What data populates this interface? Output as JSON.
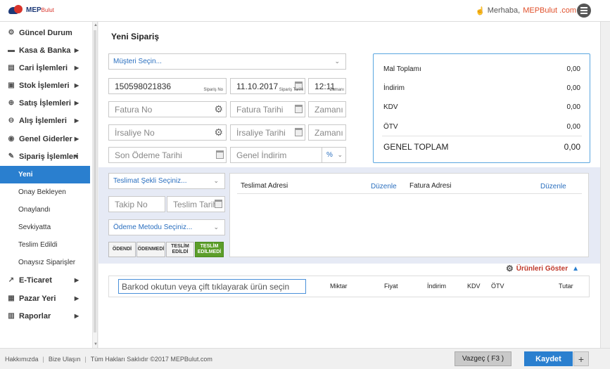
{
  "header": {
    "logo_main": "MEP",
    "logo_sub": "Bulut",
    "greeting": "Merhaba,",
    "brand": "MEPBulut .com"
  },
  "sidebar": {
    "items": [
      {
        "label": "Güncel Durum",
        "icon": "dashboard-icon"
      },
      {
        "label": "Kasa & Banka",
        "icon": "cash-icon"
      },
      {
        "label": "Cari İşlemleri",
        "icon": "accounts-icon"
      },
      {
        "label": "Stok İşlemleri",
        "icon": "stock-icon"
      },
      {
        "label": "Satış İşlemleri",
        "icon": "sales-icon"
      },
      {
        "label": "Alış İşlemleri",
        "icon": "purchase-icon"
      },
      {
        "label": "Genel Giderler",
        "icon": "expenses-icon"
      },
      {
        "label": "Sipariş İşlemleri",
        "icon": "orders-icon"
      },
      {
        "label": "E-Ticaret",
        "icon": "ecommerce-icon"
      },
      {
        "label": "Pazar Yeri",
        "icon": "marketplace-icon"
      },
      {
        "label": "Raporlar",
        "icon": "reports-icon"
      }
    ],
    "sub_items": [
      "Yeni",
      "Onay Bekleyen",
      "Onaylandı",
      "Sevkiyatta",
      "Teslim Edildi",
      "Onaysız Siparişler"
    ]
  },
  "main": {
    "title": "Yeni Sipariş",
    "customer_select": "Müşteri Seçin...",
    "order_no": "150598021836",
    "order_no_tag": "Sipariş No",
    "order_date": "11.10.2017",
    "order_date_tag": "Sipariş Tarihi",
    "order_time": "12:11",
    "order_time_tag": "Zamanı",
    "invoice_no": "Fatura No",
    "invoice_date": "Fatura Tarihi",
    "invoice_time": "Zamanı",
    "waybill_no": "İrsaliye No",
    "waybill_date": "İrsaliye Tarihi",
    "waybill_time": "Zamanı",
    "due_date": "Son Ödeme Tarihi",
    "general_discount": "Genel İndirim",
    "discount_type": "%",
    "delivery_select": "Teslimat Şekli Seçiniz...",
    "tracking_no": "Takip No",
    "delivery_date": "Teslim Tarihi",
    "payment_select": "Ödeme Metodu Seçiniz...",
    "status_buttons": [
      "ÖDENDİ",
      "ÖDENMEDİ",
      "TESLİM EDİLDİ",
      "TESLİM EDİLMEDİ"
    ],
    "delivery_address": "Teslimat Adresi",
    "invoice_address": "Fatura Adresi",
    "edit": "Düzenle",
    "show_products": "Ürünleri Göster",
    "barcode_placeholder": "Barkod okutun veya çift tıklayarak ürün seçin",
    "columns": [
      "Miktar",
      "Fiyat",
      "İndirim",
      "KDV",
      "ÖTV",
      "Tutar"
    ]
  },
  "totals": {
    "rows": [
      {
        "label": "Mal Toplamı",
        "value": "0,00"
      },
      {
        "label": "İndirim",
        "value": "0,00"
      },
      {
        "label": "KDV",
        "value": "0,00"
      },
      {
        "label": "ÖTV",
        "value": "0,00"
      }
    ],
    "grand_label": "GENEL TOPLAM",
    "grand_value": "0,00"
  },
  "footer": {
    "about": "Hakkımızda",
    "contact": "Bize Ulaşın",
    "copyright": "Tüm Hakları Saklıdır ©2017 MEPBulut.com",
    "cancel": "Vazgeç ( F3 )",
    "save": "Kaydet",
    "plus": "+"
  },
  "colors": {
    "accent": "#2a7fcf",
    "brand_red": "#d9342b",
    "active_green": "#5c9e2a"
  }
}
